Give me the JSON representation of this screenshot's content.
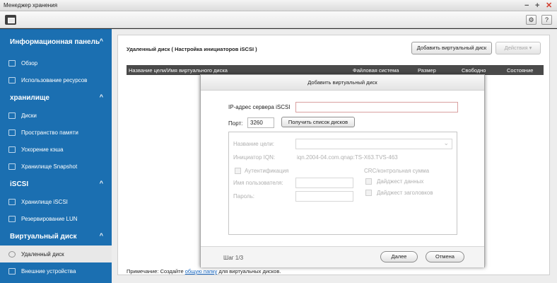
{
  "window": {
    "title": "Менеджер хранения",
    "minimize": "−",
    "maximize": "+",
    "close": "✕"
  },
  "toolbar": {
    "menu_icon": "menu-icon",
    "settings_symbol": "⚙",
    "help_symbol": "?"
  },
  "sidebar": {
    "sections": [
      {
        "label": "Информационная панель",
        "items": [
          "Обзор",
          "Использование ресурсов"
        ]
      },
      {
        "label": "хранилище",
        "items": [
          "Диски",
          "Пространство памяти",
          "Ускорение кэша",
          "Хранилище Snapshot"
        ]
      },
      {
        "label": "iSCSI",
        "items": [
          "Хранилище iSCSI",
          "Резервирование LUN"
        ]
      },
      {
        "label": "Виртуальный диск",
        "items": [
          "Удаленный диск",
          "Внешние устройства"
        ]
      }
    ],
    "chevron": "^",
    "active_item": "Удаленный диск"
  },
  "main": {
    "breadcrumb": "Удаленный диск ( Настройка инициаторов iSCSI )",
    "add_button": "Добавить виртуальный диск",
    "actions_button": "Действия ▾",
    "columns": [
      "Название цели/Имя виртуального диска",
      "Файловая система",
      "Размер",
      "Свободно",
      "Состояние"
    ],
    "footer_prefix": "Примечание: Создайте ",
    "footer_link": "общую папку",
    "footer_suffix": " для виртуальных дисков."
  },
  "modal": {
    "title": "Добавить виртуальный диск",
    "ip_label": "IP-адрес сервера iSCSI",
    "ip_value": "",
    "port_label": "Порт:",
    "port_value": "3260",
    "get_disks_button": "Получить список дисков",
    "target_label": "Название цели:",
    "initiator_label": "Инициатор IQN:",
    "initiator_value": "iqn.2004-04.com.qnap:TS-X63.TVS-463",
    "auth_label": "Аутентификация",
    "username_label": "Имя пользователя:",
    "password_label": "Пароль:",
    "crc_label": "CRC/контрольная сумма",
    "data_digest_label": "Дайджест данных",
    "header_digest_label": "Дайджест заголовков",
    "step": "Шаг 1/3",
    "next_button": "Далее",
    "cancel_button": "Отмена"
  }
}
